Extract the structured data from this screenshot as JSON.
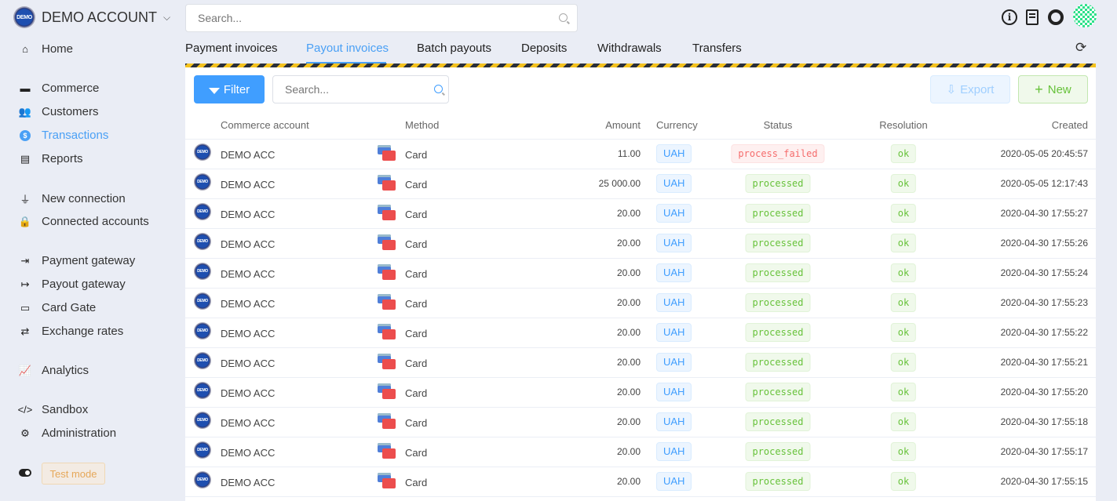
{
  "account": {
    "name": "DEMO ACCOUNT",
    "logo_text": "DEMO"
  },
  "sidebar": {
    "items": [
      {
        "label": "Home",
        "icon": "home-icon",
        "glyph": "⌂"
      },
      {
        "label": "Commerce",
        "icon": "store-icon",
        "glyph": "▬"
      },
      {
        "label": "Customers",
        "icon": "users-icon",
        "glyph": "👥"
      },
      {
        "label": "Transactions",
        "icon": "dollar-icon",
        "glyph": "$",
        "active": true
      },
      {
        "label": "Reports",
        "icon": "file-download-icon",
        "glyph": "▤"
      },
      {
        "label": "New connection",
        "icon": "plug-icon",
        "glyph": "⏚"
      },
      {
        "label": "Connected accounts",
        "icon": "lock-icon",
        "glyph": "🔒"
      },
      {
        "label": "Payment gateway",
        "icon": "sign-in-icon",
        "glyph": "⇥"
      },
      {
        "label": "Payout gateway",
        "icon": "sign-out-icon",
        "glyph": "↦"
      },
      {
        "label": "Card Gate",
        "icon": "credit-card-icon",
        "glyph": "▭"
      },
      {
        "label": "Exchange rates",
        "icon": "retweet-icon",
        "glyph": "⇄"
      },
      {
        "label": "Analytics",
        "icon": "chart-line-icon",
        "glyph": "📈"
      },
      {
        "label": "Sandbox",
        "icon": "code-icon",
        "glyph": "</>"
      },
      {
        "label": "Administration",
        "icon": "gear-icon",
        "glyph": "⚙"
      }
    ],
    "test_mode": "Test mode"
  },
  "header": {
    "search_placeholder": "Search..."
  },
  "tabs": [
    {
      "label": "Payment invoices"
    },
    {
      "label": "Payout invoices",
      "active": true
    },
    {
      "label": "Batch payouts"
    },
    {
      "label": "Deposits"
    },
    {
      "label": "Withdrawals"
    },
    {
      "label": "Transfers"
    }
  ],
  "toolbar": {
    "filter": "Filter",
    "search_placeholder": "Search...",
    "export": "Export",
    "new": "New"
  },
  "table": {
    "columns": [
      "Commerce account",
      "Method",
      "Amount",
      "Currency",
      "Status",
      "Resolution",
      "Created"
    ],
    "rows": [
      {
        "account": "DEMO ACC",
        "method": "Card",
        "amount": "11.00",
        "currency": "UAH",
        "status": "process_failed",
        "resolution": "ok",
        "created": "2020-05-05 20:45:57"
      },
      {
        "account": "DEMO ACC",
        "method": "Card",
        "amount": "25 000.00",
        "currency": "UAH",
        "status": "processed",
        "resolution": "ok",
        "created": "2020-05-05 12:17:43"
      },
      {
        "account": "DEMO ACC",
        "method": "Card",
        "amount": "20.00",
        "currency": "UAH",
        "status": "processed",
        "resolution": "ok",
        "created": "2020-04-30 17:55:27"
      },
      {
        "account": "DEMO ACC",
        "method": "Card",
        "amount": "20.00",
        "currency": "UAH",
        "status": "processed",
        "resolution": "ok",
        "created": "2020-04-30 17:55:26"
      },
      {
        "account": "DEMO ACC",
        "method": "Card",
        "amount": "20.00",
        "currency": "UAH",
        "status": "processed",
        "resolution": "ok",
        "created": "2020-04-30 17:55:24"
      },
      {
        "account": "DEMO ACC",
        "method": "Card",
        "amount": "20.00",
        "currency": "UAH",
        "status": "processed",
        "resolution": "ok",
        "created": "2020-04-30 17:55:23"
      },
      {
        "account": "DEMO ACC",
        "method": "Card",
        "amount": "20.00",
        "currency": "UAH",
        "status": "processed",
        "resolution": "ok",
        "created": "2020-04-30 17:55:22"
      },
      {
        "account": "DEMO ACC",
        "method": "Card",
        "amount": "20.00",
        "currency": "UAH",
        "status": "processed",
        "resolution": "ok",
        "created": "2020-04-30 17:55:21"
      },
      {
        "account": "DEMO ACC",
        "method": "Card",
        "amount": "20.00",
        "currency": "UAH",
        "status": "processed",
        "resolution": "ok",
        "created": "2020-04-30 17:55:20"
      },
      {
        "account": "DEMO ACC",
        "method": "Card",
        "amount": "20.00",
        "currency": "UAH",
        "status": "processed",
        "resolution": "ok",
        "created": "2020-04-30 17:55:18"
      },
      {
        "account": "DEMO ACC",
        "method": "Card",
        "amount": "20.00",
        "currency": "UAH",
        "status": "processed",
        "resolution": "ok",
        "created": "2020-04-30 17:55:17"
      },
      {
        "account": "DEMO ACC",
        "method": "Card",
        "amount": "20.00",
        "currency": "UAH",
        "status": "processed",
        "resolution": "ok",
        "created": "2020-04-30 17:55:15"
      }
    ]
  }
}
